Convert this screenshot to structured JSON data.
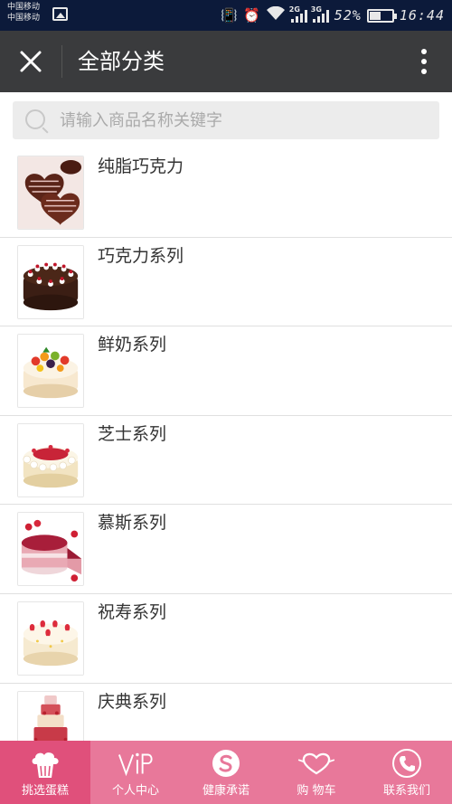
{
  "status_bar": {
    "carrier_1": "中国移动",
    "carrier_2": "中国移动",
    "network_1": "2G",
    "network_2": "3G",
    "battery_percent": "52%",
    "battery_level": 0.52,
    "time": "16:44"
  },
  "header": {
    "title": "全部分类"
  },
  "search": {
    "placeholder": "请输入商品名称关键字"
  },
  "categories": [
    {
      "label": "纯脂巧克力",
      "image": "chocolate-heart-cakes"
    },
    {
      "label": "巧克力系列",
      "image": "chocolate-cake"
    },
    {
      "label": "鲜奶系列",
      "image": "fruit-cream-cake"
    },
    {
      "label": "芝士系列",
      "image": "strawberry-cheese-cake"
    },
    {
      "label": "慕斯系列",
      "image": "mousse-cake-slice"
    },
    {
      "label": "祝寿系列",
      "image": "strawberry-birthday-cake"
    },
    {
      "label": "庆典系列",
      "image": "tiered-celebration-cake"
    }
  ],
  "tabbar": {
    "accent_color": "#e8789a",
    "active_color": "#e0507b",
    "tabs": [
      {
        "label": "挑选蛋糕",
        "icon": "cake-icon",
        "active": true
      },
      {
        "label": "个人中心",
        "icon": "vip-icon",
        "active": false
      },
      {
        "label": "健康承诺",
        "icon": "s-badge-icon",
        "active": false
      },
      {
        "label": "购 物车",
        "icon": "heart-cart-icon",
        "active": false
      },
      {
        "label": "联系我们",
        "icon": "phone-icon",
        "active": false
      }
    ]
  }
}
